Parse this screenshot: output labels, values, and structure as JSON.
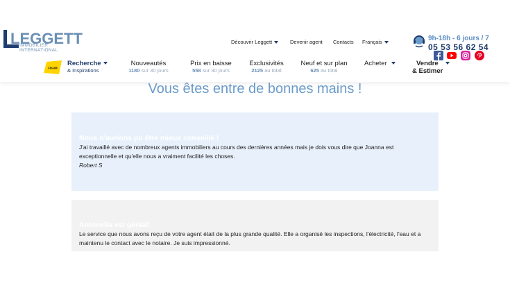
{
  "brand": {
    "name": "LEGGETT",
    "tagline": "IMMOBILIER INTERNATIONAL"
  },
  "topnav": [
    {
      "label": "Découvrir Leggett",
      "dropdown": true
    },
    {
      "label": "Devenir agent",
      "dropdown": false
    },
    {
      "label": "Contacts",
      "dropdown": false
    },
    {
      "label": "Français",
      "dropdown": true
    }
  ],
  "contact": {
    "hours": "9h-18h - 6 jours / 7",
    "phone": "05 53 56 62 54"
  },
  "social": [
    {
      "name": "facebook-icon",
      "color": "#3b5998"
    },
    {
      "name": "youtube-icon",
      "color": "#ff0000"
    },
    {
      "name": "instagram-icon",
      "color": "#d6249f"
    },
    {
      "name": "pinterest-icon",
      "color": "#e60023"
    }
  ],
  "fnaim": {
    "label": "FNAIM"
  },
  "mainnav": {
    "recherche": {
      "title": "Recherche",
      "sub": "& Inspirations"
    },
    "nouveautes": {
      "title": "Nouveautés",
      "count": "1180",
      "period": " sur 30 jours"
    },
    "prix": {
      "title": "Prix en baisse",
      "count": "558",
      "period": " sur 30 jours"
    },
    "exclusivites": {
      "title": "Exclusivités",
      "count": "2125",
      "period": " au total"
    },
    "neuf": {
      "title": "Neuf et sur plan",
      "count": "625",
      "period": " au total"
    },
    "acheter": {
      "title": "Acheter"
    },
    "vendre": {
      "title": "Vendre",
      "sub": "& Estimer"
    }
  },
  "headline": "Vous êtes entre de bonnes mains !",
  "testimonials": [
    {
      "title": "Nous n'aurions pu être mieux conseillé !",
      "body": "J'ai travaillé avec de nombreux agents immobiliers au cours des dernières années mais je dois vous dire que Joanna est exceptionnelle et qu'elle nous a vraiment facilité les choses.",
      "author": "Robert S"
    },
    {
      "title": "Antonella est génial!",
      "body": "Le service que nous avons reçu de votre agent était de la plus grande qualité. Elle a organisé les inspections, l'électricité, l'eau et a maintenu le contact avec le notaire. Je suis impressionné."
    }
  ],
  "colors": {
    "brand_dark": "#1f3c6e",
    "brand_light": "#6a8fb5",
    "accent": "#5d8dc4"
  }
}
